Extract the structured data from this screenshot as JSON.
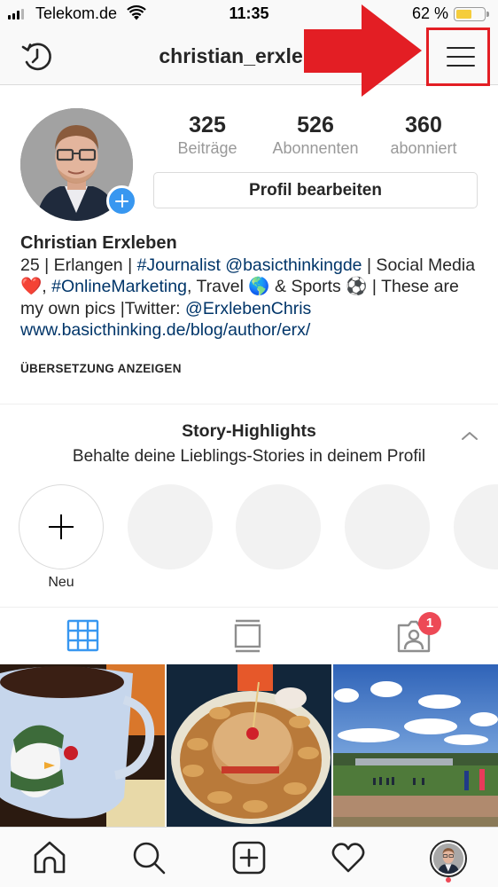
{
  "status_bar": {
    "carrier": "Telekom.de",
    "time": "11:35",
    "battery_percent_label": "62 %",
    "battery_level": 0.62,
    "signal_bars_active": 3,
    "signal_bars_total": 4
  },
  "header": {
    "username": "christian_erxleben",
    "left_icon": "archive-history-icon",
    "right_icon": "hamburger-menu-icon"
  },
  "annotation": {
    "arrow_color": "#e31e24",
    "box_color": "#e31e24",
    "points_to": "menu-button"
  },
  "profile": {
    "stats": [
      {
        "value": "325",
        "label": "Beiträge"
      },
      {
        "value": "526",
        "label": "Abonnenten"
      },
      {
        "value": "360",
        "label": "abonniert"
      }
    ],
    "edit_button_label": "Profil bearbeiten",
    "name": "Christian Erxleben",
    "bio": {
      "line1_pre": "25 | Erlangen | ",
      "hashtag_journalist": "#Journalist",
      "mention_basicthinking": "@basicthinkingde",
      "line1_post": " | Social Media ",
      "heart_emoji": "❤️",
      "comma": ", ",
      "hashtag_onlinemarketing": "#OnlineMarketing",
      "travel_text": ", Travel ",
      "globe_emoji": "🌎",
      "sports_text": " & Sports ",
      "soccer_emoji": "⚽",
      "line3_pre": " | These are my own pics |Twitter: ",
      "mention_twitter": "@ErxlebenChris"
    },
    "website": "www.basicthinking.de/blog/author/erx/",
    "translate_label": "ÜBERSETZUNG ANZEIGEN"
  },
  "highlights": {
    "title": "Story-Highlights",
    "subtitle": "Behalte deine Lieblings-Stories in deinem Profil",
    "new_label": "Neu",
    "placeholder_count": 4
  },
  "tabs": {
    "items": [
      {
        "name": "grid",
        "active": true
      },
      {
        "name": "feed",
        "active": false
      },
      {
        "name": "tagged",
        "active": false
      }
    ],
    "tagged_badge": "1",
    "active_color": "#3897f0"
  },
  "posts": [
    {
      "description": "Mug with penguin motif"
    },
    {
      "description": "Burger with potato wedges"
    },
    {
      "description": "Football field under blue sky"
    }
  ],
  "bottom_nav": {
    "items": [
      "home",
      "search",
      "new-post",
      "activity",
      "profile"
    ]
  },
  "colors": {
    "link": "#003569",
    "badge_red": "#ed4956",
    "blue": "#3897f0"
  }
}
